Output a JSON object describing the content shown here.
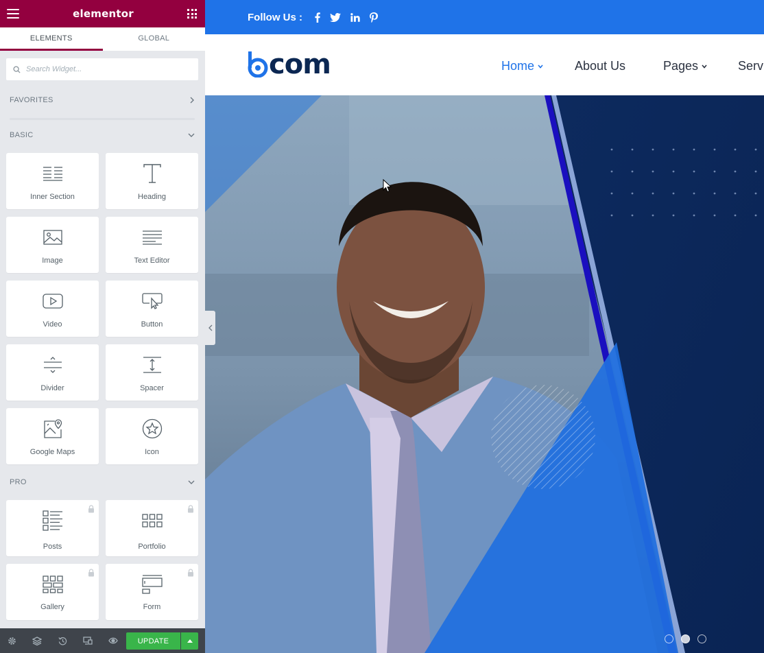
{
  "panel": {
    "brand": "elementor",
    "tabs": [
      {
        "label": "ELEMENTS",
        "active": true
      },
      {
        "label": "GLOBAL",
        "active": false
      }
    ],
    "search_placeholder": "Search Widget...",
    "categories": {
      "favorites": "FAVORITES",
      "basic": "BASIC",
      "pro": "PRO"
    },
    "basic_widgets": [
      {
        "label": "Inner Section",
        "icon": "inner-section-icon"
      },
      {
        "label": "Heading",
        "icon": "heading-icon"
      },
      {
        "label": "Image",
        "icon": "image-icon"
      },
      {
        "label": "Text Editor",
        "icon": "text-editor-icon"
      },
      {
        "label": "Video",
        "icon": "video-icon"
      },
      {
        "label": "Button",
        "icon": "button-icon"
      },
      {
        "label": "Divider",
        "icon": "divider-icon"
      },
      {
        "label": "Spacer",
        "icon": "spacer-icon"
      },
      {
        "label": "Google Maps",
        "icon": "google-maps-icon"
      },
      {
        "label": "Icon",
        "icon": "star-icon"
      }
    ],
    "pro_widgets": [
      {
        "label": "Posts",
        "icon": "posts-icon",
        "locked": true
      },
      {
        "label": "Portfolio",
        "icon": "portfolio-icon",
        "locked": true
      },
      {
        "label": "Gallery",
        "icon": "gallery-icon",
        "locked": true
      },
      {
        "label": "Form",
        "icon": "form-icon",
        "locked": true
      }
    ],
    "footer": {
      "update_label": "UPDATE",
      "icons": [
        "settings-icon",
        "navigator-icon",
        "history-icon",
        "responsive-icon",
        "preview-icon"
      ]
    }
  },
  "site": {
    "follow_label": "Follow Us :",
    "social_icons": [
      "facebook-icon",
      "twitter-icon",
      "linkedin-icon",
      "pinterest-icon"
    ],
    "logo_text": "com",
    "nav": [
      {
        "label": "Home",
        "active": true,
        "dropdown": true
      },
      {
        "label": "About Us",
        "active": false,
        "dropdown": false
      },
      {
        "label": "Pages",
        "active": false,
        "dropdown": true
      },
      {
        "label": "Serv",
        "active": false,
        "dropdown": false
      }
    ],
    "colors": {
      "brand_blue": "#1f73e8",
      "navy": "#0b2752",
      "elementor_maroon": "#93003f",
      "update_green": "#39b54a"
    },
    "slider": {
      "slides": 3,
      "active_slide": 2
    }
  }
}
